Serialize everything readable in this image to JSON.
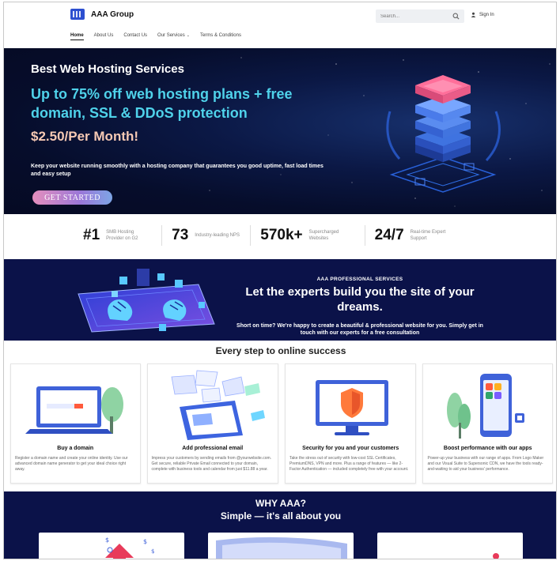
{
  "brand": {
    "name": "AAA Group",
    "accent": "#2d4fd0"
  },
  "header": {
    "search_placeholder": "Search...",
    "signin_label": "Sign In",
    "nav": [
      {
        "label": "Home",
        "active": true
      },
      {
        "label": "About Us"
      },
      {
        "label": "Contact Us"
      },
      {
        "label": "Our Services",
        "has_dropdown": true
      },
      {
        "label": "Terms & Conditions"
      }
    ]
  },
  "hero": {
    "kicker": "Best Web Hosting Services",
    "headline": "Up to 75% off web hosting plans + free domain, SSL & DDoS protection",
    "price": "$2.50/Per Month!",
    "description": "Keep your website running smoothly with a hosting company that guarantees you good uptime, fast load times and easy setup",
    "cta": "GET STARTED",
    "colors": {
      "headline": "#4fd2ea",
      "price": "#f6c9b4",
      "background": "#060d2b"
    }
  },
  "stats": [
    {
      "value": "#1",
      "label": "SMB Hosting Provider on G2"
    },
    {
      "value": "73",
      "label": "Industry-leading NPS"
    },
    {
      "value": "570k+",
      "label": "Supercharged Websites"
    },
    {
      "value": "24/7",
      "label": "Real-time Expert Support"
    }
  ],
  "experts": {
    "kicker": "AAA PROFESSIONAL SERVICES",
    "title": "Let the experts build you the site of your dreams.",
    "subtitle": "Short on time? We're happy to create a beautiful & professional website for you. Simply get in touch with our experts for a free consultation"
  },
  "steps": {
    "title": "Every step to online success",
    "cards": [
      {
        "title": "Buy a domain",
        "text": "Register a domain name and create your online identity. Use our advanced domain name generator to get your ideal choice right away."
      },
      {
        "title": "Add professional email",
        "text": "Impress your customers by sending emails from @yourwebsite.com. Get secure, reliable Private Email connected to your domain, complete with business tools and calendar from just $11.88 a year."
      },
      {
        "title": "Security for you and your customers",
        "text": "Take the stress out of security with low-cost SSL Certificates, PremiumDNS, VPN and more. Plus a range of features — like 2-Factor Authentication — included completely free with your account."
      },
      {
        "title": "Boost performance with our apps",
        "text": "Power-up your business with our range of apps. From Logo Maker and our Visual Suite to Supersonic CDN, we have the tools ready-and-waiting to aid your business' performance."
      }
    ]
  },
  "why": {
    "title": "WHY AAA?",
    "subtitle": "Simple — it's all about you"
  }
}
